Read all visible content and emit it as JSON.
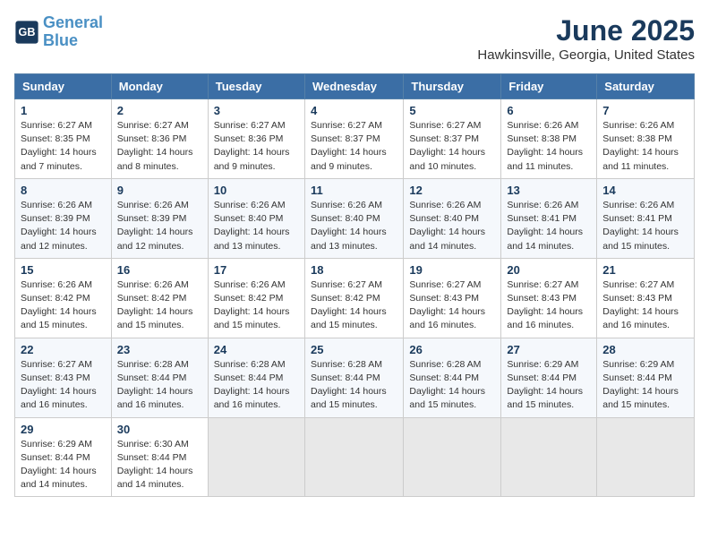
{
  "header": {
    "logo_line1": "General",
    "logo_line2": "Blue",
    "month": "June 2025",
    "location": "Hawkinsville, Georgia, United States"
  },
  "weekdays": [
    "Sunday",
    "Monday",
    "Tuesday",
    "Wednesday",
    "Thursday",
    "Friday",
    "Saturday"
  ],
  "weeks": [
    [
      {
        "day": "1",
        "sunrise": "6:27 AM",
        "sunset": "8:35 PM",
        "daylight": "14 hours and 7 minutes."
      },
      {
        "day": "2",
        "sunrise": "6:27 AM",
        "sunset": "8:36 PM",
        "daylight": "14 hours and 8 minutes."
      },
      {
        "day": "3",
        "sunrise": "6:27 AM",
        "sunset": "8:36 PM",
        "daylight": "14 hours and 9 minutes."
      },
      {
        "day": "4",
        "sunrise": "6:27 AM",
        "sunset": "8:37 PM",
        "daylight": "14 hours and 9 minutes."
      },
      {
        "day": "5",
        "sunrise": "6:27 AM",
        "sunset": "8:37 PM",
        "daylight": "14 hours and 10 minutes."
      },
      {
        "day": "6",
        "sunrise": "6:26 AM",
        "sunset": "8:38 PM",
        "daylight": "14 hours and 11 minutes."
      },
      {
        "day": "7",
        "sunrise": "6:26 AM",
        "sunset": "8:38 PM",
        "daylight": "14 hours and 11 minutes."
      }
    ],
    [
      {
        "day": "8",
        "sunrise": "6:26 AM",
        "sunset": "8:39 PM",
        "daylight": "14 hours and 12 minutes."
      },
      {
        "day": "9",
        "sunrise": "6:26 AM",
        "sunset": "8:39 PM",
        "daylight": "14 hours and 12 minutes."
      },
      {
        "day": "10",
        "sunrise": "6:26 AM",
        "sunset": "8:40 PM",
        "daylight": "14 hours and 13 minutes."
      },
      {
        "day": "11",
        "sunrise": "6:26 AM",
        "sunset": "8:40 PM",
        "daylight": "14 hours and 13 minutes."
      },
      {
        "day": "12",
        "sunrise": "6:26 AM",
        "sunset": "8:40 PM",
        "daylight": "14 hours and 14 minutes."
      },
      {
        "day": "13",
        "sunrise": "6:26 AM",
        "sunset": "8:41 PM",
        "daylight": "14 hours and 14 minutes."
      },
      {
        "day": "14",
        "sunrise": "6:26 AM",
        "sunset": "8:41 PM",
        "daylight": "14 hours and 15 minutes."
      }
    ],
    [
      {
        "day": "15",
        "sunrise": "6:26 AM",
        "sunset": "8:42 PM",
        "daylight": "14 hours and 15 minutes."
      },
      {
        "day": "16",
        "sunrise": "6:26 AM",
        "sunset": "8:42 PM",
        "daylight": "14 hours and 15 minutes."
      },
      {
        "day": "17",
        "sunrise": "6:26 AM",
        "sunset": "8:42 PM",
        "daylight": "14 hours and 15 minutes."
      },
      {
        "day": "18",
        "sunrise": "6:27 AM",
        "sunset": "8:42 PM",
        "daylight": "14 hours and 15 minutes."
      },
      {
        "day": "19",
        "sunrise": "6:27 AM",
        "sunset": "8:43 PM",
        "daylight": "14 hours and 16 minutes."
      },
      {
        "day": "20",
        "sunrise": "6:27 AM",
        "sunset": "8:43 PM",
        "daylight": "14 hours and 16 minutes."
      },
      {
        "day": "21",
        "sunrise": "6:27 AM",
        "sunset": "8:43 PM",
        "daylight": "14 hours and 16 minutes."
      }
    ],
    [
      {
        "day": "22",
        "sunrise": "6:27 AM",
        "sunset": "8:43 PM",
        "daylight": "14 hours and 16 minutes."
      },
      {
        "day": "23",
        "sunrise": "6:28 AM",
        "sunset": "8:44 PM",
        "daylight": "14 hours and 16 minutes."
      },
      {
        "day": "24",
        "sunrise": "6:28 AM",
        "sunset": "8:44 PM",
        "daylight": "14 hours and 16 minutes."
      },
      {
        "day": "25",
        "sunrise": "6:28 AM",
        "sunset": "8:44 PM",
        "daylight": "14 hours and 15 minutes."
      },
      {
        "day": "26",
        "sunrise": "6:28 AM",
        "sunset": "8:44 PM",
        "daylight": "14 hours and 15 minutes."
      },
      {
        "day": "27",
        "sunrise": "6:29 AM",
        "sunset": "8:44 PM",
        "daylight": "14 hours and 15 minutes."
      },
      {
        "day": "28",
        "sunrise": "6:29 AM",
        "sunset": "8:44 PM",
        "daylight": "14 hours and 15 minutes."
      }
    ],
    [
      {
        "day": "29",
        "sunrise": "6:29 AM",
        "sunset": "8:44 PM",
        "daylight": "14 hours and 14 minutes."
      },
      {
        "day": "30",
        "sunrise": "6:30 AM",
        "sunset": "8:44 PM",
        "daylight": "14 hours and 14 minutes."
      },
      null,
      null,
      null,
      null,
      null
    ]
  ],
  "labels": {
    "sunrise": "Sunrise:",
    "sunset": "Sunset:",
    "daylight": "Daylight:"
  }
}
